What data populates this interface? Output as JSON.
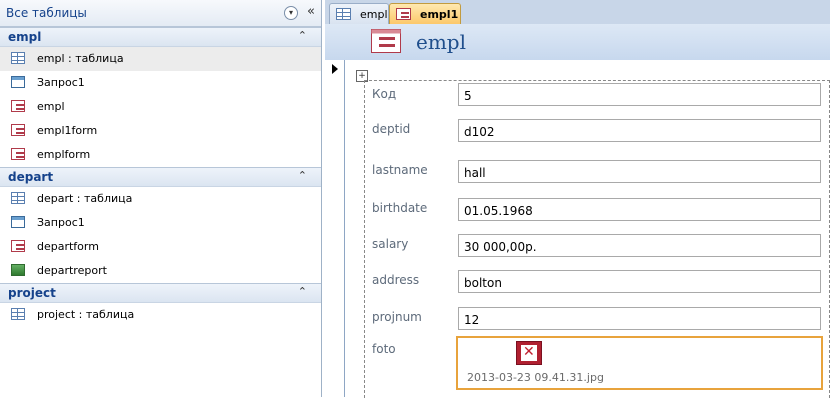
{
  "nav": {
    "title": "Все таблицы",
    "dropdown_glyph": "▾",
    "collapse_glyph": "«",
    "groups": [
      {
        "title": "empl",
        "items": [
          {
            "label": "empl : таблица",
            "icon": "table-icon",
            "selected": true
          },
          {
            "label": "Запрос1",
            "icon": "query-icon",
            "selected": false
          },
          {
            "label": "empl",
            "icon": "form-icon",
            "selected": false
          },
          {
            "label": "empl1form",
            "icon": "form-icon",
            "selected": false
          },
          {
            "label": "emplform",
            "icon": "form-icon",
            "selected": false
          }
        ]
      },
      {
        "title": "depart",
        "items": [
          {
            "label": "depart : таблица",
            "icon": "table-icon",
            "selected": false
          },
          {
            "label": "Запрос1",
            "icon": "query-icon",
            "selected": false
          },
          {
            "label": "departform",
            "icon": "form-icon",
            "selected": false
          },
          {
            "label": "departreport",
            "icon": "report-icon",
            "selected": false
          }
        ]
      },
      {
        "title": "project",
        "items": [
          {
            "label": "project : таблица",
            "icon": "table-icon",
            "selected": false
          }
        ]
      }
    ]
  },
  "tabs": [
    {
      "label": "empl",
      "icon": "table-icon",
      "active": false
    },
    {
      "label": "empl1",
      "icon": "form-icon",
      "active": true
    }
  ],
  "form": {
    "title": "empl",
    "fields": [
      {
        "label": "Код",
        "value": "5"
      },
      {
        "label": "deptid",
        "value": "d102"
      },
      {
        "label": "lastname",
        "value": "hall"
      },
      {
        "label": "birthdate",
        "value": "01.05.1968"
      },
      {
        "label": "salary",
        "value": "30 000,00р."
      },
      {
        "label": "address",
        "value": "bolton"
      },
      {
        "label": "projnum",
        "value": "12"
      }
    ],
    "foto": {
      "label": "foto",
      "filename": "2013-03-23 09.41.31.jpg"
    }
  },
  "colors": {
    "accent": "#15428b",
    "active_tab": "#fcc86a",
    "focus_border": "#e8a33c"
  }
}
